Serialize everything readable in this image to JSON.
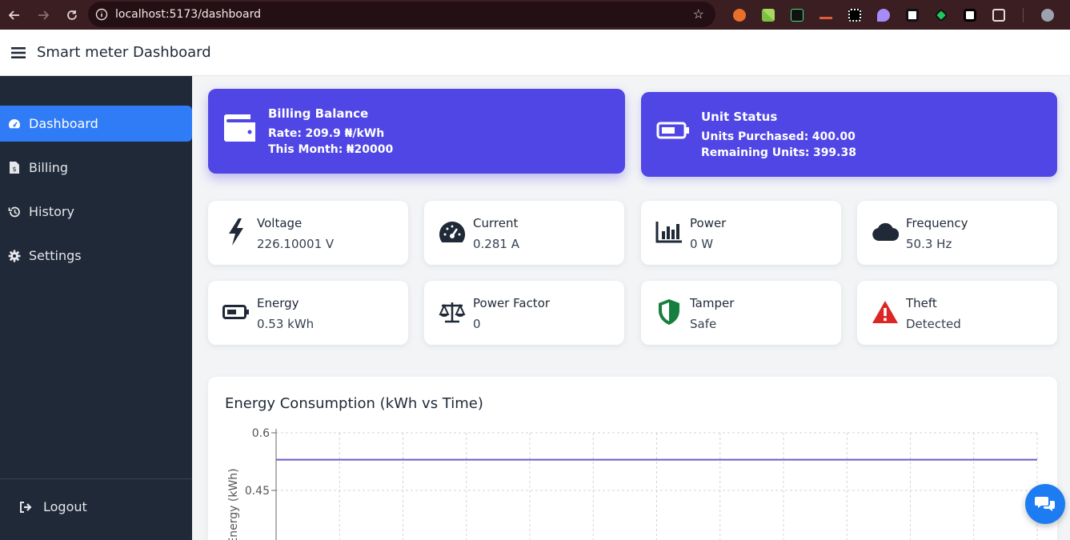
{
  "browser": {
    "url": "localhost:5173/dashboard",
    "extensions": [
      "fox-extension-icon",
      "chart-extension-icon",
      "terminal-extension-icon",
      "wave-extension-icon",
      "grid-extension-icon",
      "pin-extension-icon",
      "calc-extension-icon",
      "diamond-extension-icon",
      "slash-extension-icon",
      "puzzle-icon"
    ]
  },
  "header": {
    "title": "Smart meter Dashboard"
  },
  "sidebar": {
    "items": [
      {
        "label": "Dashboard",
        "icon": "gauge-icon",
        "active": true
      },
      {
        "label": "Billing",
        "icon": "invoice-icon",
        "active": false
      },
      {
        "label": "History",
        "icon": "history-icon",
        "active": false
      },
      {
        "label": "Settings",
        "icon": "gear-icon",
        "active": false
      }
    ],
    "logout_label": "Logout"
  },
  "billing": {
    "title": "Billing Balance",
    "rate_label": "Rate:",
    "rate_value": "209.9 ₦/kWh",
    "month_label": "This Month:",
    "month_value": "₦20000"
  },
  "units": {
    "title": "Unit Status",
    "purchased_label": "Units Purchased:",
    "purchased_value": "400.00",
    "remaining_label": "Remaining Units:",
    "remaining_value": "399.38"
  },
  "stats": [
    {
      "label": "Voltage",
      "value": "226.10001 V",
      "icon": "bolt-icon"
    },
    {
      "label": "Current",
      "value": "0.281 A",
      "icon": "gauge-icon"
    },
    {
      "label": "Power",
      "value": "0 W",
      "icon": "bar-chart-icon"
    },
    {
      "label": "Frequency",
      "value": "50.3 Hz",
      "icon": "cloud-icon"
    },
    {
      "label": "Energy",
      "value": "0.53 kWh",
      "icon": "battery-icon"
    },
    {
      "label": "Power Factor",
      "value": "0",
      "icon": "scale-icon"
    },
    {
      "label": "Tamper",
      "value": "Safe",
      "icon": "shield-icon"
    },
    {
      "label": "Theft",
      "value": "Detected",
      "icon": "warning-icon"
    }
  ],
  "colors": {
    "accent": "#4f46e5",
    "sidebar": "#1f2937",
    "active_item": "#2f7cf6",
    "tamper_green": "#15803d",
    "theft_red": "#dc2626",
    "line": "#6b5bc9"
  },
  "chart_data": {
    "type": "line",
    "title": "Energy Consumption (kWh vs Time)",
    "ylabel": "Energy (kWh)",
    "xlabel": "",
    "yticks": [
      "0.6",
      "0.45"
    ],
    "ylim": [
      0.45,
      0.6
    ],
    "grid": true,
    "series": [
      {
        "values": [
          0.53,
          0.53,
          0.53,
          0.53,
          0.53,
          0.53,
          0.53,
          0.53,
          0.53,
          0.53,
          0.53,
          0.53,
          0.53
        ]
      }
    ]
  }
}
